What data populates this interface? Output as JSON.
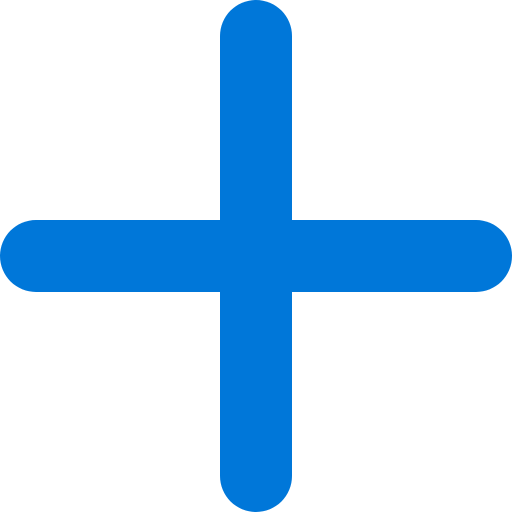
{
  "icon": {
    "name": "plus-icon",
    "color": "#0077D9",
    "background": "#FFFFFF"
  }
}
